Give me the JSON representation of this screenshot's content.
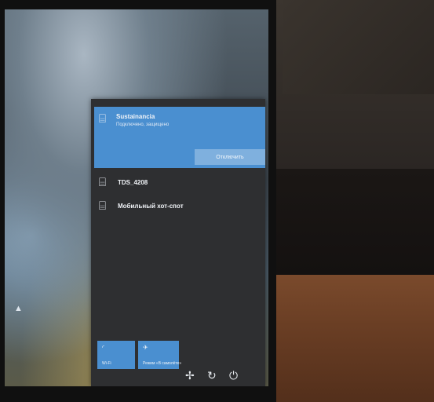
{
  "networks": {
    "active": {
      "name": "Sustainancia",
      "status": "Подключено, защищено",
      "disconnect_label": "Отключить"
    },
    "items": [
      {
        "name": "TDS_4208"
      },
      {
        "name": "Мобильный хот-спот"
      }
    ]
  },
  "quick_actions": [
    {
      "icon": "wifi-icon",
      "label": "Wi-Fi"
    },
    {
      "icon": "airplane-icon",
      "label": "Режим «В самолёте»"
    }
  ],
  "system_icons": [
    "accessibility-icon",
    "network-icon",
    "power-icon"
  ],
  "colors": {
    "accent": "#4a8fd0",
    "panel": "#2e2f31",
    "disconnect_button": "#7fb0de"
  }
}
